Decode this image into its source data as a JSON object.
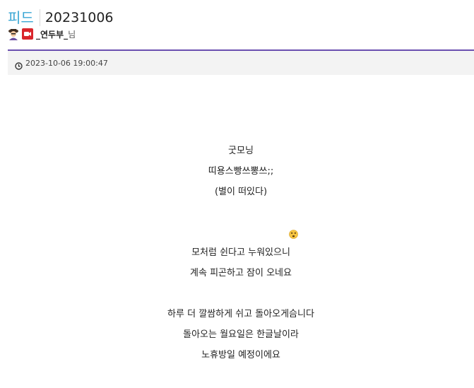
{
  "header": {
    "section_label": "피드",
    "post_title": "20231006",
    "author_name": "_연두부_",
    "author_suffix": "님",
    "avatar_icon": "character-avatar-icon",
    "badge_icon": "video-camera-icon",
    "accent_color": "#6a4fb0",
    "section_color": "#39a6d4"
  },
  "meta": {
    "clock_icon": "clock-icon",
    "timestamp": "2023-10-06 19:00:47"
  },
  "body": {
    "lines": [
      "굿모닝",
      "띠용스빵쓰뽕쓰;;",
      "(별이 떠있다)",
      "모처럼 쉰다고 누워있으니",
      "계속 피곤하고 잠이 오네요",
      "하루 더 깔쌈하게 쉬고 돌아오게슴니다",
      "돌아오는 월요일은 한글날이라",
      "노휴방일 예정이에요"
    ],
    "emoji_icon": "dizzy-face-emoji-icon"
  }
}
